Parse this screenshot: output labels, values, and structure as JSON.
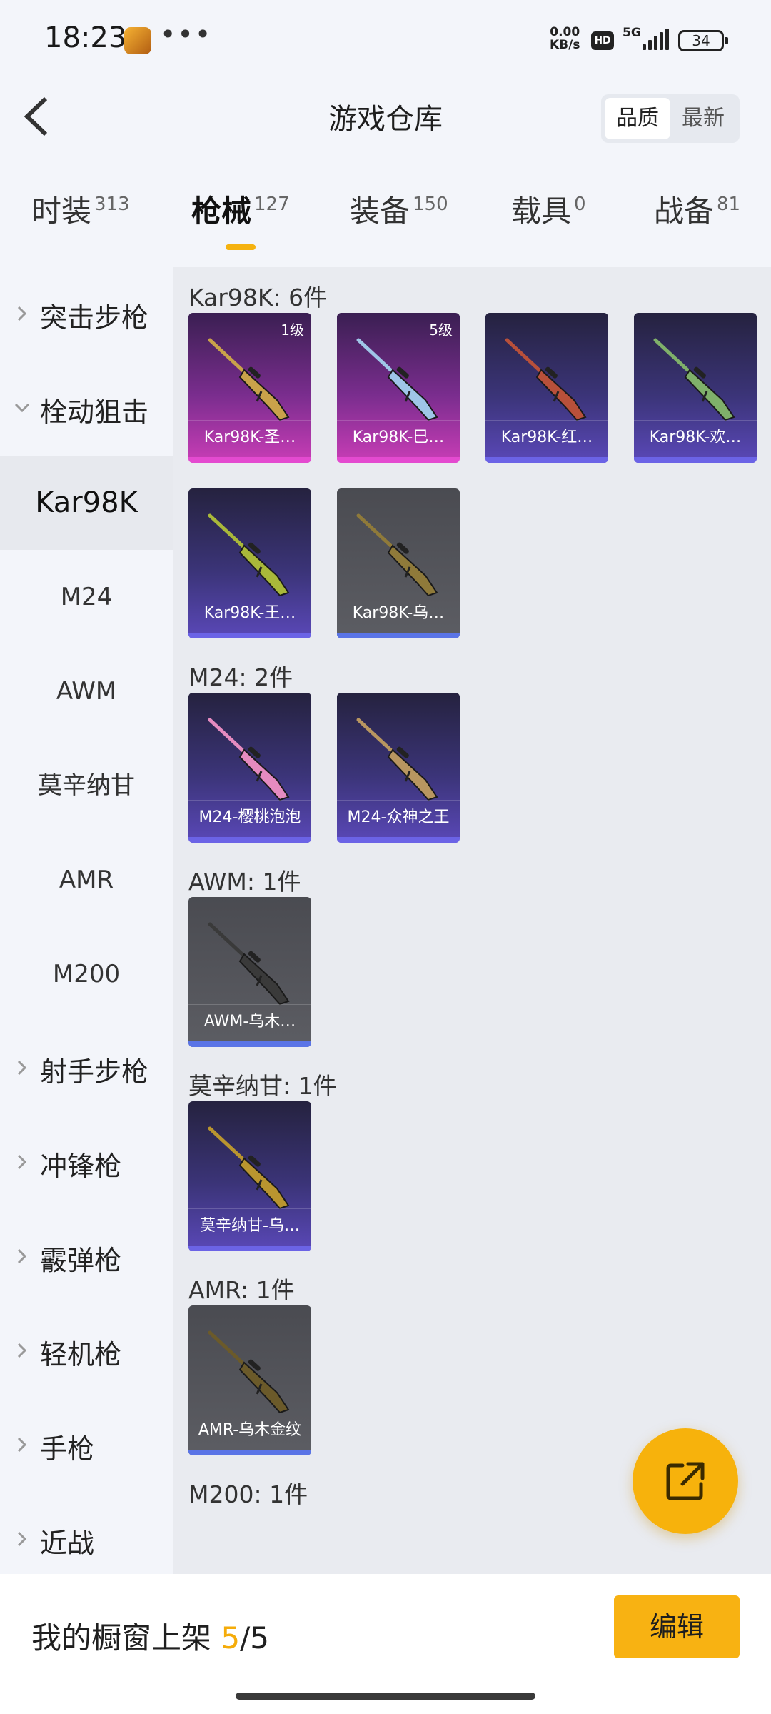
{
  "status": {
    "time": "18:23",
    "speed_value": "0.00",
    "speed_unit": "KB/s",
    "hd": "HD",
    "network": "5G",
    "battery": "34"
  },
  "header": {
    "title": "游戏仓库",
    "sort_quality": "品质",
    "sort_newest": "最新"
  },
  "tabs": [
    {
      "label": "时装",
      "count": "313"
    },
    {
      "label": "枪械",
      "count": "127",
      "active": true
    },
    {
      "label": "装备",
      "count": "150"
    },
    {
      "label": "载具",
      "count": "0"
    },
    {
      "label": "战备",
      "count": "81"
    }
  ],
  "sidebar": {
    "groups": [
      {
        "label": "突击步枪",
        "expanded": false
      },
      {
        "label": "栓动狙击",
        "expanded": true
      },
      {
        "label": "射手步枪",
        "expanded": false
      },
      {
        "label": "冲锋枪",
        "expanded": false
      },
      {
        "label": "霰弹枪",
        "expanded": false
      },
      {
        "label": "轻机枪",
        "expanded": false
      },
      {
        "label": "手枪",
        "expanded": false
      },
      {
        "label": "近战",
        "expanded": false
      }
    ],
    "subitems": [
      "Kar98K",
      "M24",
      "AWM",
      "莫辛纳甘",
      "AMR",
      "M200"
    ],
    "selected": "Kar98K"
  },
  "sections": [
    {
      "title": "Kar98K: 6件",
      "items": [
        {
          "name": "Kar98K-圣…",
          "level": "1级",
          "rarity": "pink",
          "gun_color": "#c9a24a"
        },
        {
          "name": "Kar98K-巳…",
          "level": "5级",
          "rarity": "pink",
          "gun_color": "#9fc6e8"
        },
        {
          "name": "Kar98K-红…",
          "level": "",
          "rarity": "blue",
          "gun_color": "#b8503a"
        },
        {
          "name": "Kar98K-欢…",
          "level": "",
          "rarity": "blue",
          "gun_color": "#7fb06a"
        },
        {
          "name": "Kar98K-王…",
          "level": "",
          "rarity": "blue",
          "gun_color": "#a9b83a"
        },
        {
          "name": "Kar98K-乌…",
          "level": "",
          "rarity": "gray",
          "gun_color": "#8f7a3a"
        }
      ]
    },
    {
      "title": "M24: 2件",
      "items": [
        {
          "name": "M24-樱桃泡泡",
          "level": "",
          "rarity": "blue",
          "gun_color": "#e58bc0"
        },
        {
          "name": "M24-众神之王",
          "level": "",
          "rarity": "blue",
          "gun_color": "#b89660"
        }
      ]
    },
    {
      "title": "AWM: 1件",
      "items": [
        {
          "name": "AWM-乌木…",
          "level": "",
          "rarity": "gray",
          "gun_color": "#3a3a3a"
        }
      ]
    },
    {
      "title": "莫辛纳甘: 1件",
      "items": [
        {
          "name": "莫辛纳甘-乌…",
          "level": "",
          "rarity": "blue",
          "gun_color": "#b9952f"
        }
      ]
    },
    {
      "title": "AMR: 1件",
      "items": [
        {
          "name": "AMR-乌木金纹",
          "level": "",
          "rarity": "gray",
          "gun_color": "#6b5a2a"
        }
      ]
    },
    {
      "title": "M200: 1件",
      "items": []
    }
  ],
  "showcase": {
    "label": "我的橱窗上架",
    "current": "5",
    "total": "/5"
  },
  "edit_button": "编辑"
}
